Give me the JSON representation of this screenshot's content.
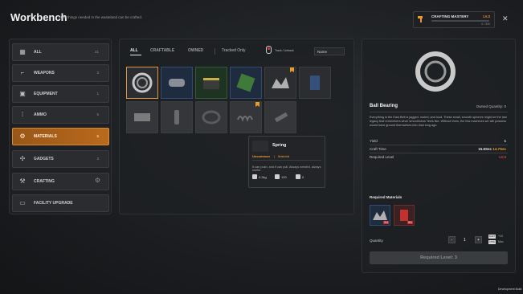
{
  "window": {
    "title": "Workbench",
    "subtitle": "Most things needed in the wasteland can be crafted.",
    "dev_build": "Development Build"
  },
  "mastery": {
    "label": "CRAFTING MASTERY",
    "level": "LV.3",
    "progress_text": "0 / 300",
    "progress_fraction": 0.0,
    "icon": "hammer-icon"
  },
  "sidebar": {
    "items": [
      {
        "label": "ALL",
        "count": "21",
        "icon": "grid-icon"
      },
      {
        "label": "WEAPONS",
        "count": "3",
        "icon": "pistol-icon"
      },
      {
        "label": "EQUIPMENT",
        "count": "1",
        "icon": "vest-icon"
      },
      {
        "label": "AMMO",
        "count": "5",
        "icon": "ammo-icon"
      },
      {
        "label": "MATERIALS",
        "count": "5",
        "icon": "gears-icon"
      },
      {
        "label": "GADGETS",
        "count": "3",
        "icon": "gadget-icon"
      },
      {
        "label": "CRAFTING",
        "count": "",
        "icon": "wrench-icon"
      },
      {
        "label": "FACILITY UPGRADE",
        "count": "",
        "icon": "facility-icon"
      }
    ]
  },
  "tabs": [
    {
      "label": "ALL"
    },
    {
      "label": "CRAFTABLE"
    },
    {
      "label": "OWNED"
    }
  ],
  "filters": {
    "tracked_only": "Tracked Only",
    "track_untrack": "Track / Untrack",
    "sort_value": "Name"
  },
  "tooltip": {
    "name": "Spring",
    "rarity": "Uncommon",
    "separator": "|",
    "type": "Material",
    "description": "It can push, and it can pull. Always needed, always useful.",
    "weight": "0.2kg",
    "value": "120",
    "stack": "0"
  },
  "details": {
    "name": "Ball Bearing",
    "owned": "Owned Quantity: 0",
    "description": "Everything in the East Belt is jagged, rusted, and loud. These small, smooth spheres might be the last legacy that remembers what 'smoothness' feels like. Without them, the few machines we still possess would have ground themselves into dust long ago.",
    "yield_label": "Yield",
    "yield_value": "1",
    "craft_time_label": "Craft Time",
    "craft_time_a": "15.6Sec",
    "craft_time_b": "14.7Sec",
    "req_level_label": "Required Level",
    "req_level_value": "LV.3",
    "required_materials_title": "Required Materials",
    "materials": [
      {
        "icon": "scrap-metal-icon",
        "count": "2/4"
      },
      {
        "icon": "fuel-can-icon",
        "count": "0/1"
      }
    ],
    "quantity_label": "Quantity",
    "quantity_value": "1",
    "minus": "-",
    "plus": "+",
    "shift_key": "SHIFT",
    "ctrl_key": "CTRL",
    "shift_mod": "+10",
    "ctrl_mod": "Max",
    "craft_button": "Required Level: 3"
  }
}
